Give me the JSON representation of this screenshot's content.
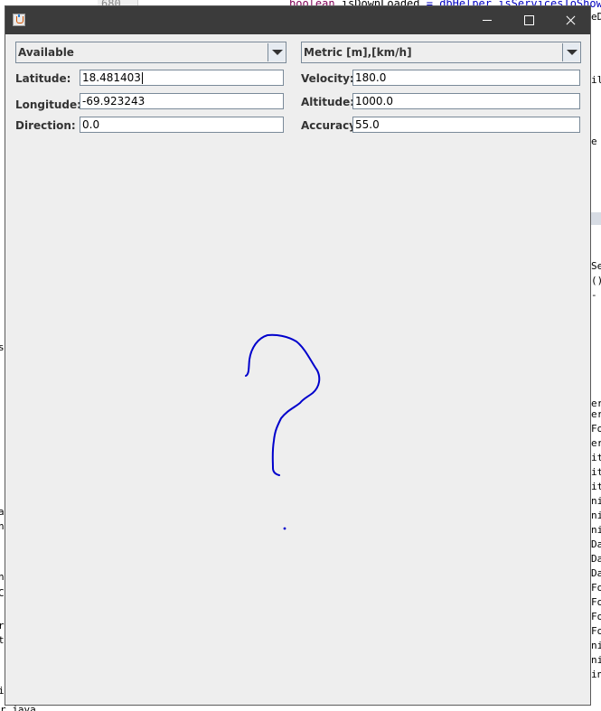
{
  "background": {
    "line_number": "680",
    "code_keyword": "boolean",
    "code_var": "isDownLoaded",
    "code_rest": "= dbHelper.isServicesToShow",
    "right_fragments": [
      "eD",
      "il",
      "e",
      "Se",
      "()",
      "-",
      "er",
      "er",
      "Fo",
      "er",
      "it",
      "it",
      "it",
      "ni",
      "ni",
      "ni",
      "Da",
      "Da",
      "Da",
      "Fo",
      "Fo",
      "Fo",
      "Fo",
      "ni",
      "ni",
      "in"
    ],
    "left_fragments": [
      "s",
      "a",
      "n",
      "n",
      "C",
      "r",
      "t",
      "i"
    ],
    "bottom_fragment": "r.java"
  },
  "window": {
    "title": ""
  },
  "status_combo": {
    "selected": "Available"
  },
  "units_combo": {
    "selected": "Metric [m],[km/h]"
  },
  "fields": {
    "latitude": {
      "label": "Latitude:",
      "value": "18.481403"
    },
    "longitude": {
      "label": "Longitude:",
      "value": "-69.923243"
    },
    "direction": {
      "label": "Direction:",
      "value": "0.0"
    },
    "velocity": {
      "label": "Velocity:",
      "value": "180.0"
    },
    "altitude": {
      "label": "Altitude:",
      "value": "1000.0"
    },
    "accuracy": {
      "label": "Accuracy:",
      "value": "55.0"
    }
  },
  "drawing": {
    "stroke_color": "#0000cc",
    "shape": "question-mark"
  },
  "colors": {
    "titlebar": "#3b3b3b",
    "window_bg": "#eeeeee"
  }
}
